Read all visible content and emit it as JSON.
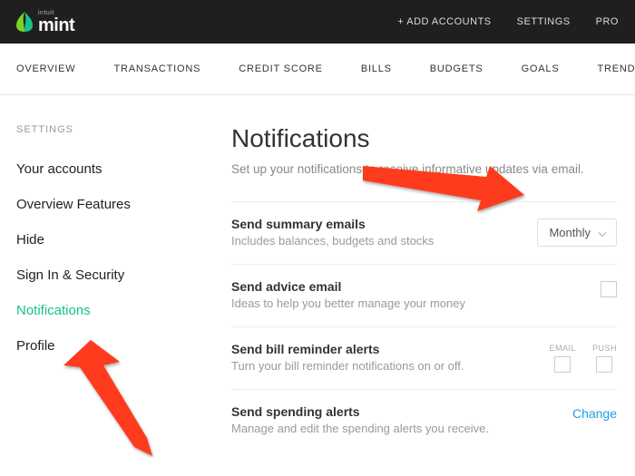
{
  "topbar": {
    "brand_small": "intuit",
    "brand": "mint",
    "links": [
      "+ ADD ACCOUNTS",
      "SETTINGS",
      "PRO"
    ]
  },
  "nav": {
    "tabs": [
      "OVERVIEW",
      "TRANSACTIONS",
      "CREDIT SCORE",
      "BILLS",
      "BUDGETS",
      "GOALS",
      "TRENDS"
    ]
  },
  "sidebar": {
    "title": "SETTINGS",
    "items": [
      {
        "label": "Your accounts"
      },
      {
        "label": "Overview Features"
      },
      {
        "label": "Hide"
      },
      {
        "label": "Sign In & Security"
      },
      {
        "label": "Notifications",
        "active": true
      },
      {
        "label": "Profile"
      }
    ]
  },
  "page": {
    "title": "Notifications",
    "subtitle": "Set up your notifications to receive informative updates via email."
  },
  "settings": [
    {
      "title": "Send summary emails",
      "desc": "Includes balances, budgets and stocks",
      "control": "select",
      "select_value": "Monthly"
    },
    {
      "title": "Send advice email",
      "desc": "Ideas to help you better manage your money",
      "control": "checkbox"
    },
    {
      "title": "Send bill reminder alerts",
      "desc": "Turn your bill reminder notifications on or off.",
      "control": "dual_checkbox",
      "cols": [
        "EMAIL",
        "PUSH"
      ]
    },
    {
      "title": "Send spending alerts",
      "desc": "Manage and edit the spending alerts you receive.",
      "control": "link",
      "link_label": "Change"
    }
  ],
  "colors": {
    "accent": "#17c28f",
    "link": "#1ea0e6",
    "arrow": "#fe3b1f"
  }
}
